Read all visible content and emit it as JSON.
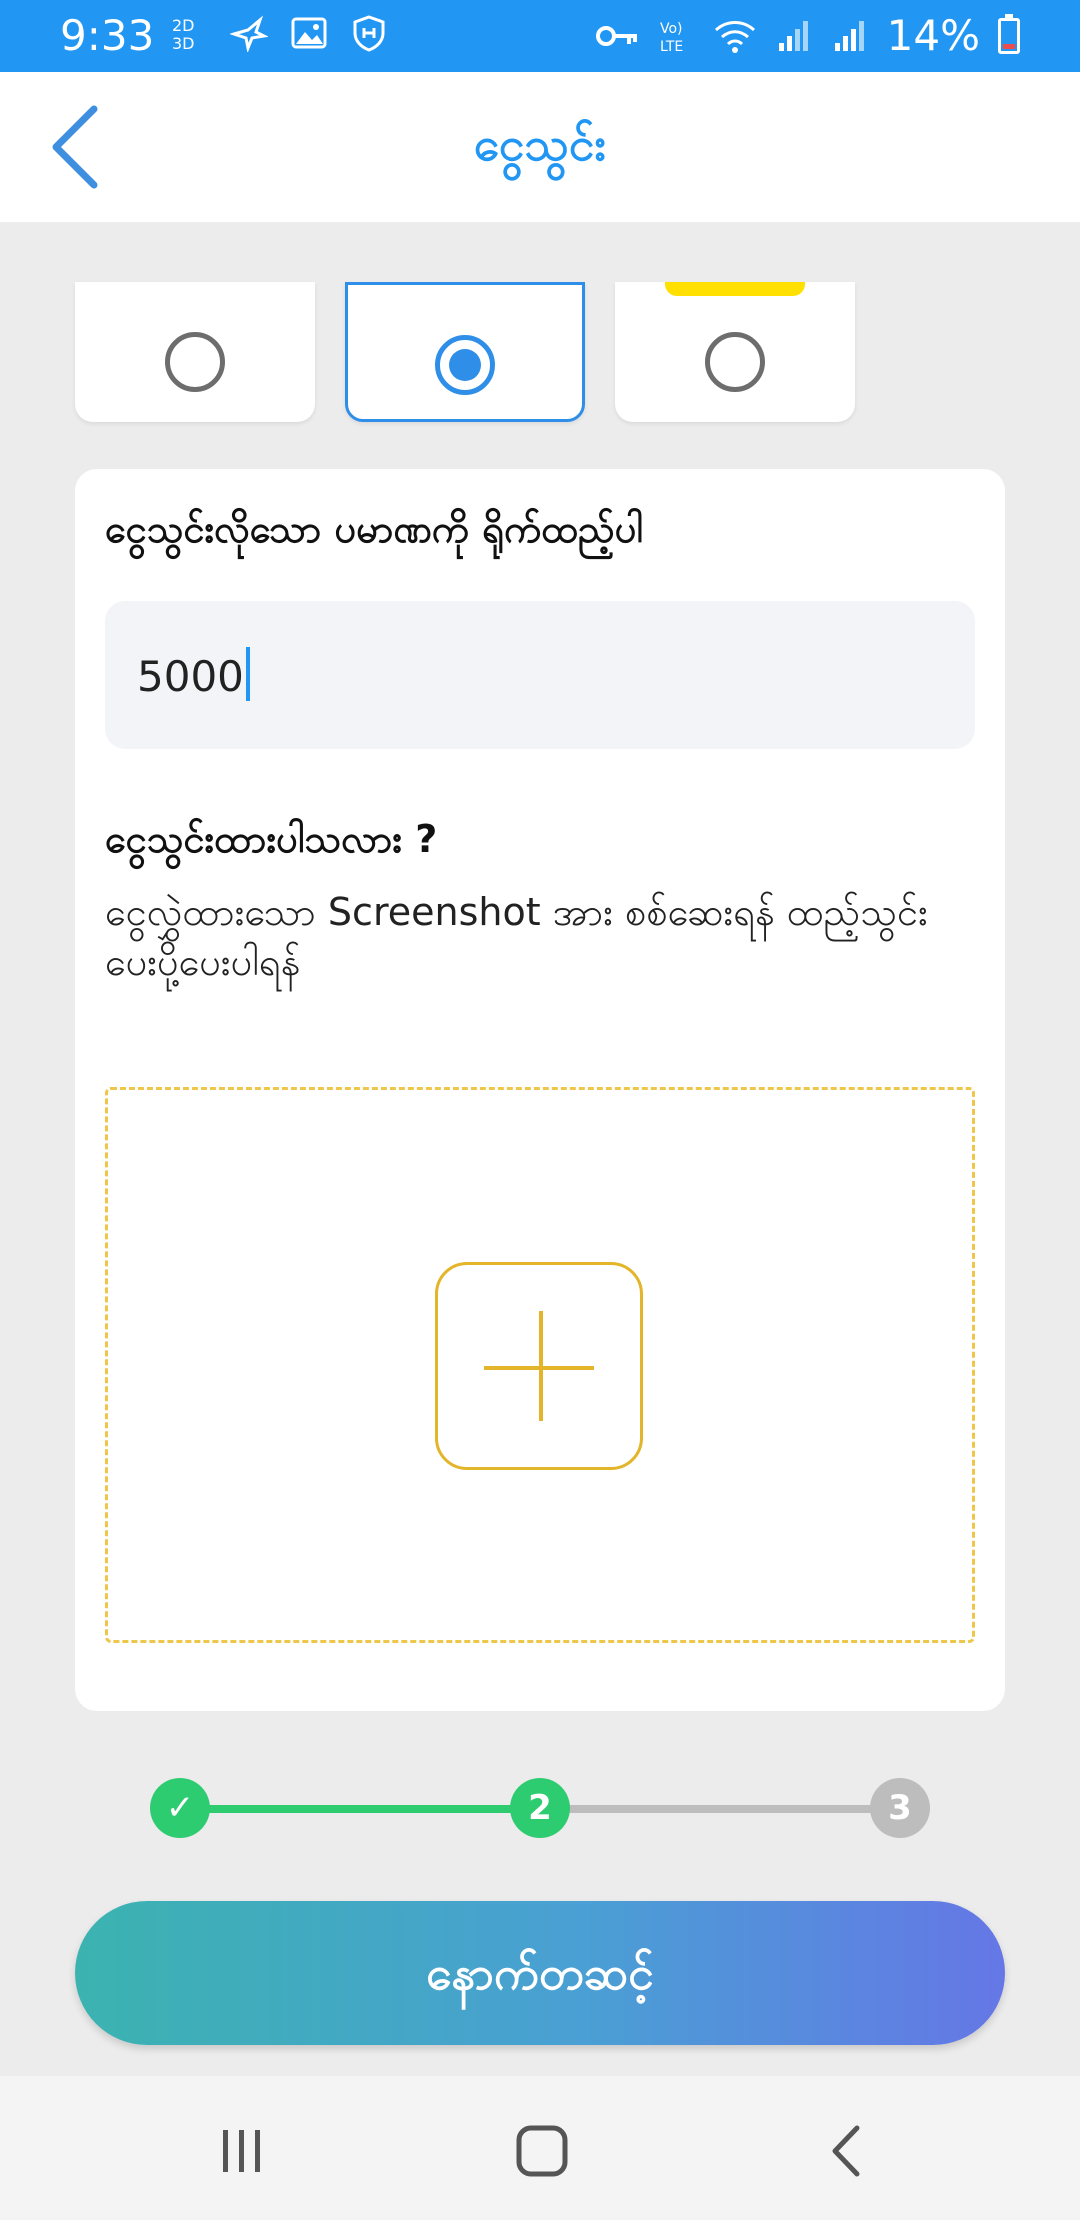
{
  "status_bar": {
    "time": "9:33",
    "battery": "14%",
    "icons": [
      "2d-3d-icon",
      "bird-icon",
      "image-icon",
      "shield-icon",
      "key-icon",
      "volte-icon",
      "wifi-icon",
      "signal-icon",
      "signal-icon",
      "battery-icon"
    ]
  },
  "header": {
    "title": "ငွေသွင်း"
  },
  "payment_options": [
    {
      "selected": false
    },
    {
      "selected": true
    },
    {
      "selected": false
    }
  ],
  "form": {
    "amount_label": "ငွေသွင်းလိုသော ပမာဏကို ရိုက်ထည့်ပါ",
    "amount_value": "5000",
    "question": "ငွေသွင်းထားပါသလား ?",
    "description": "ငွေလွှဲထားသော Screenshot အား စစ်ဆေးရန် ထည့်သွင်း ပေးပို့ပေးပါရန်"
  },
  "stepper": {
    "current_step": 2,
    "steps": [
      "✓",
      "2",
      "3"
    ]
  },
  "next_button": {
    "label": "နောက်တဆင့်"
  },
  "colors": {
    "accent": "#2196f3",
    "success": "#2ecc71",
    "upload_border": "#edc64a"
  }
}
